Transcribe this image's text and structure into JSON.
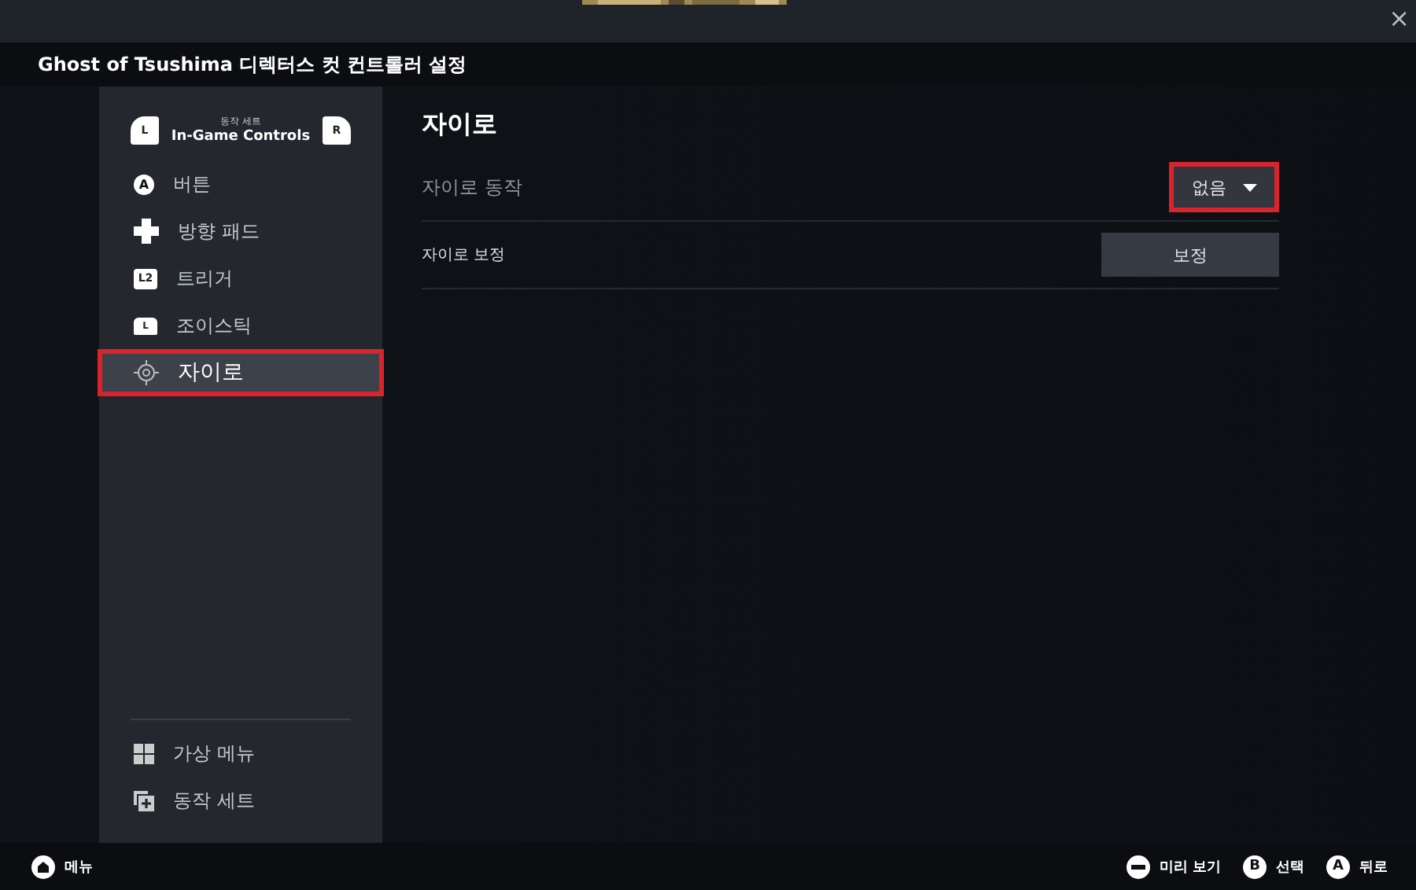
{
  "window": {
    "title": "Ghost of Tsushima 디렉터스 컷 컨트롤러 설정",
    "close": "×"
  },
  "action_set": {
    "caption": "동작 세트",
    "name": "In-Game Controls",
    "left_key": "L",
    "right_key": "R"
  },
  "sidebar": {
    "items": [
      {
        "kind": "button",
        "label": "버튼",
        "badge": "A",
        "selected": false,
        "highlighted": false
      },
      {
        "kind": "dpad",
        "label": "방향 패드",
        "selected": false,
        "highlighted": false
      },
      {
        "kind": "trigger",
        "label": "트리거",
        "badge": "L2",
        "selected": false,
        "highlighted": false
      },
      {
        "kind": "joystick",
        "label": "조이스틱",
        "badge": "L",
        "selected": false,
        "highlighted": false
      },
      {
        "kind": "gyro",
        "label": "자이로",
        "selected": true,
        "highlighted": true
      }
    ],
    "bottom_items": [
      {
        "kind": "grid",
        "label": "가상 메뉴"
      },
      {
        "kind": "sets",
        "label": "동작 세트"
      }
    ]
  },
  "content": {
    "title": "자이로",
    "rows": [
      {
        "kind": "dropdown",
        "label": "자이로 동작",
        "value": "없음",
        "highlighted": true
      },
      {
        "kind": "button",
        "label": "자이로 보정",
        "value": "보정"
      }
    ]
  },
  "footer": {
    "left": {
      "label": "메뉴"
    },
    "hints": [
      {
        "kind": "minus",
        "label": "미리 보기"
      },
      {
        "kind": "letter",
        "glyph": "B",
        "label": "선택"
      },
      {
        "kind": "letter",
        "glyph": "A",
        "label": "뒤로"
      }
    ]
  }
}
